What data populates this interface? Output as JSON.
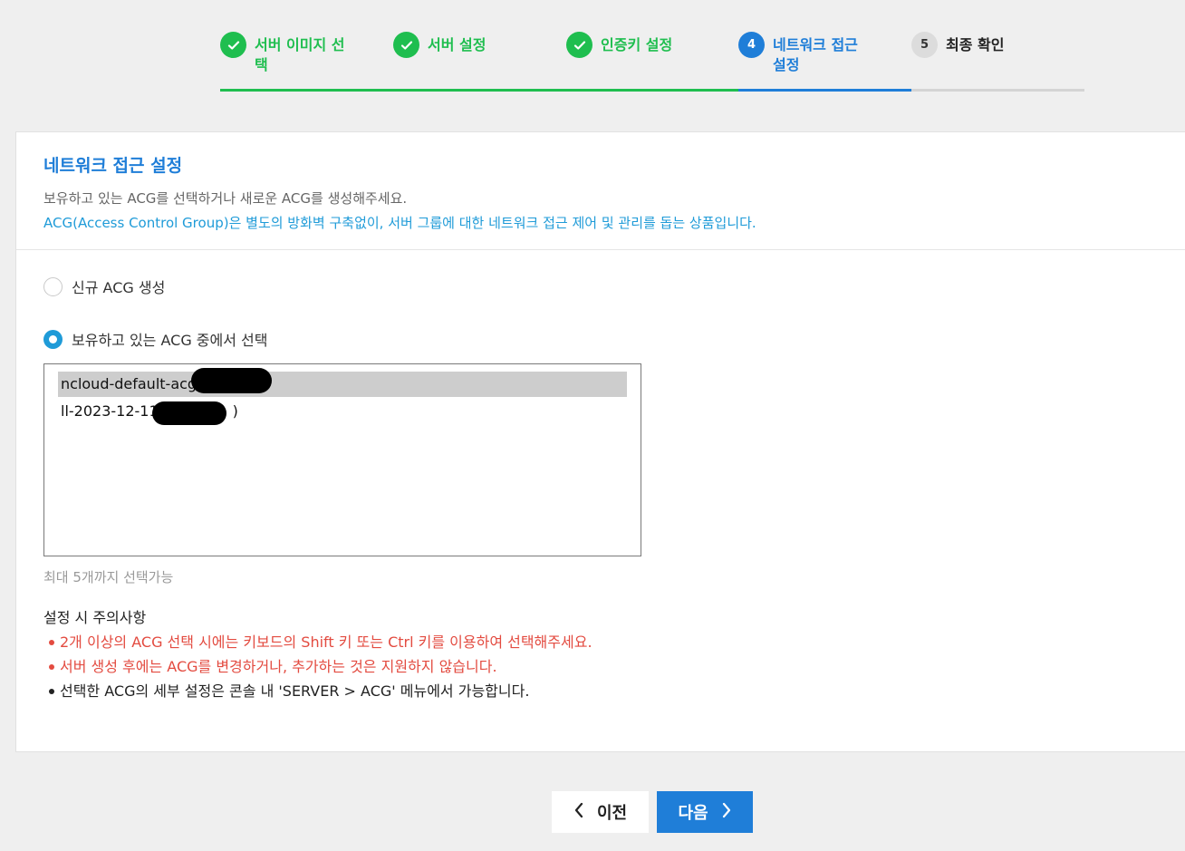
{
  "stepper": {
    "steps": [
      {
        "label": "서버 이미지 선택",
        "state": "done"
      },
      {
        "label": "서버 설정",
        "state": "done"
      },
      {
        "label": "인증키 설정",
        "state": "done"
      },
      {
        "label": "네트워크 접근 설정",
        "number": "4",
        "state": "active"
      },
      {
        "label": "최종 확인",
        "number": "5",
        "state": "todo"
      }
    ]
  },
  "section": {
    "title": "네트워크 접근 설정",
    "desc1": "보유하고 있는 ACG를 선택하거나 새로운 ACG를 생성해주세요.",
    "desc2": "ACG(Access Control Group)은 별도의 방화벽 구축없이, 서버 그룹에 대한 네트워크 접근 제어 및 관리를 돕는 상품입니다."
  },
  "options": {
    "new_acg": "신규 ACG 생성",
    "existing_acg": "보유하고 있는 ACG 중에서 선택",
    "selected": "existing_acg"
  },
  "acg_list": [
    {
      "text": "ncloud-default-acg",
      "selected": true
    },
    {
      "text": "ll-2023-12-11",
      "suffix": ")",
      "selected": false
    }
  ],
  "hint": "최대 5개까지 선택가능",
  "notes": {
    "title": "설정 시 주의사항",
    "items": [
      {
        "text": "2개 이상의 ACG 선택 시에는 키보드의 Shift 키 또는 Ctrl 키를 이용하여 선택해주세요.",
        "color": "#e34b40"
      },
      {
        "text": "서버 생성 후에는 ACG를 변경하거나, 추가하는 것은 지원하지 않습니다.",
        "color": "#e34b40"
      },
      {
        "text": "선택한 ACG의 세부 설정은 콘솔 내 'SERVER > ACG' 메뉴에서 가능합니다.",
        "color": "#222222"
      }
    ]
  },
  "buttons": {
    "prev": "이전",
    "next": "다음"
  },
  "icons": {
    "check": "check-icon",
    "prev": "chevron-left-icon",
    "next": "chevron-right-icon"
  }
}
